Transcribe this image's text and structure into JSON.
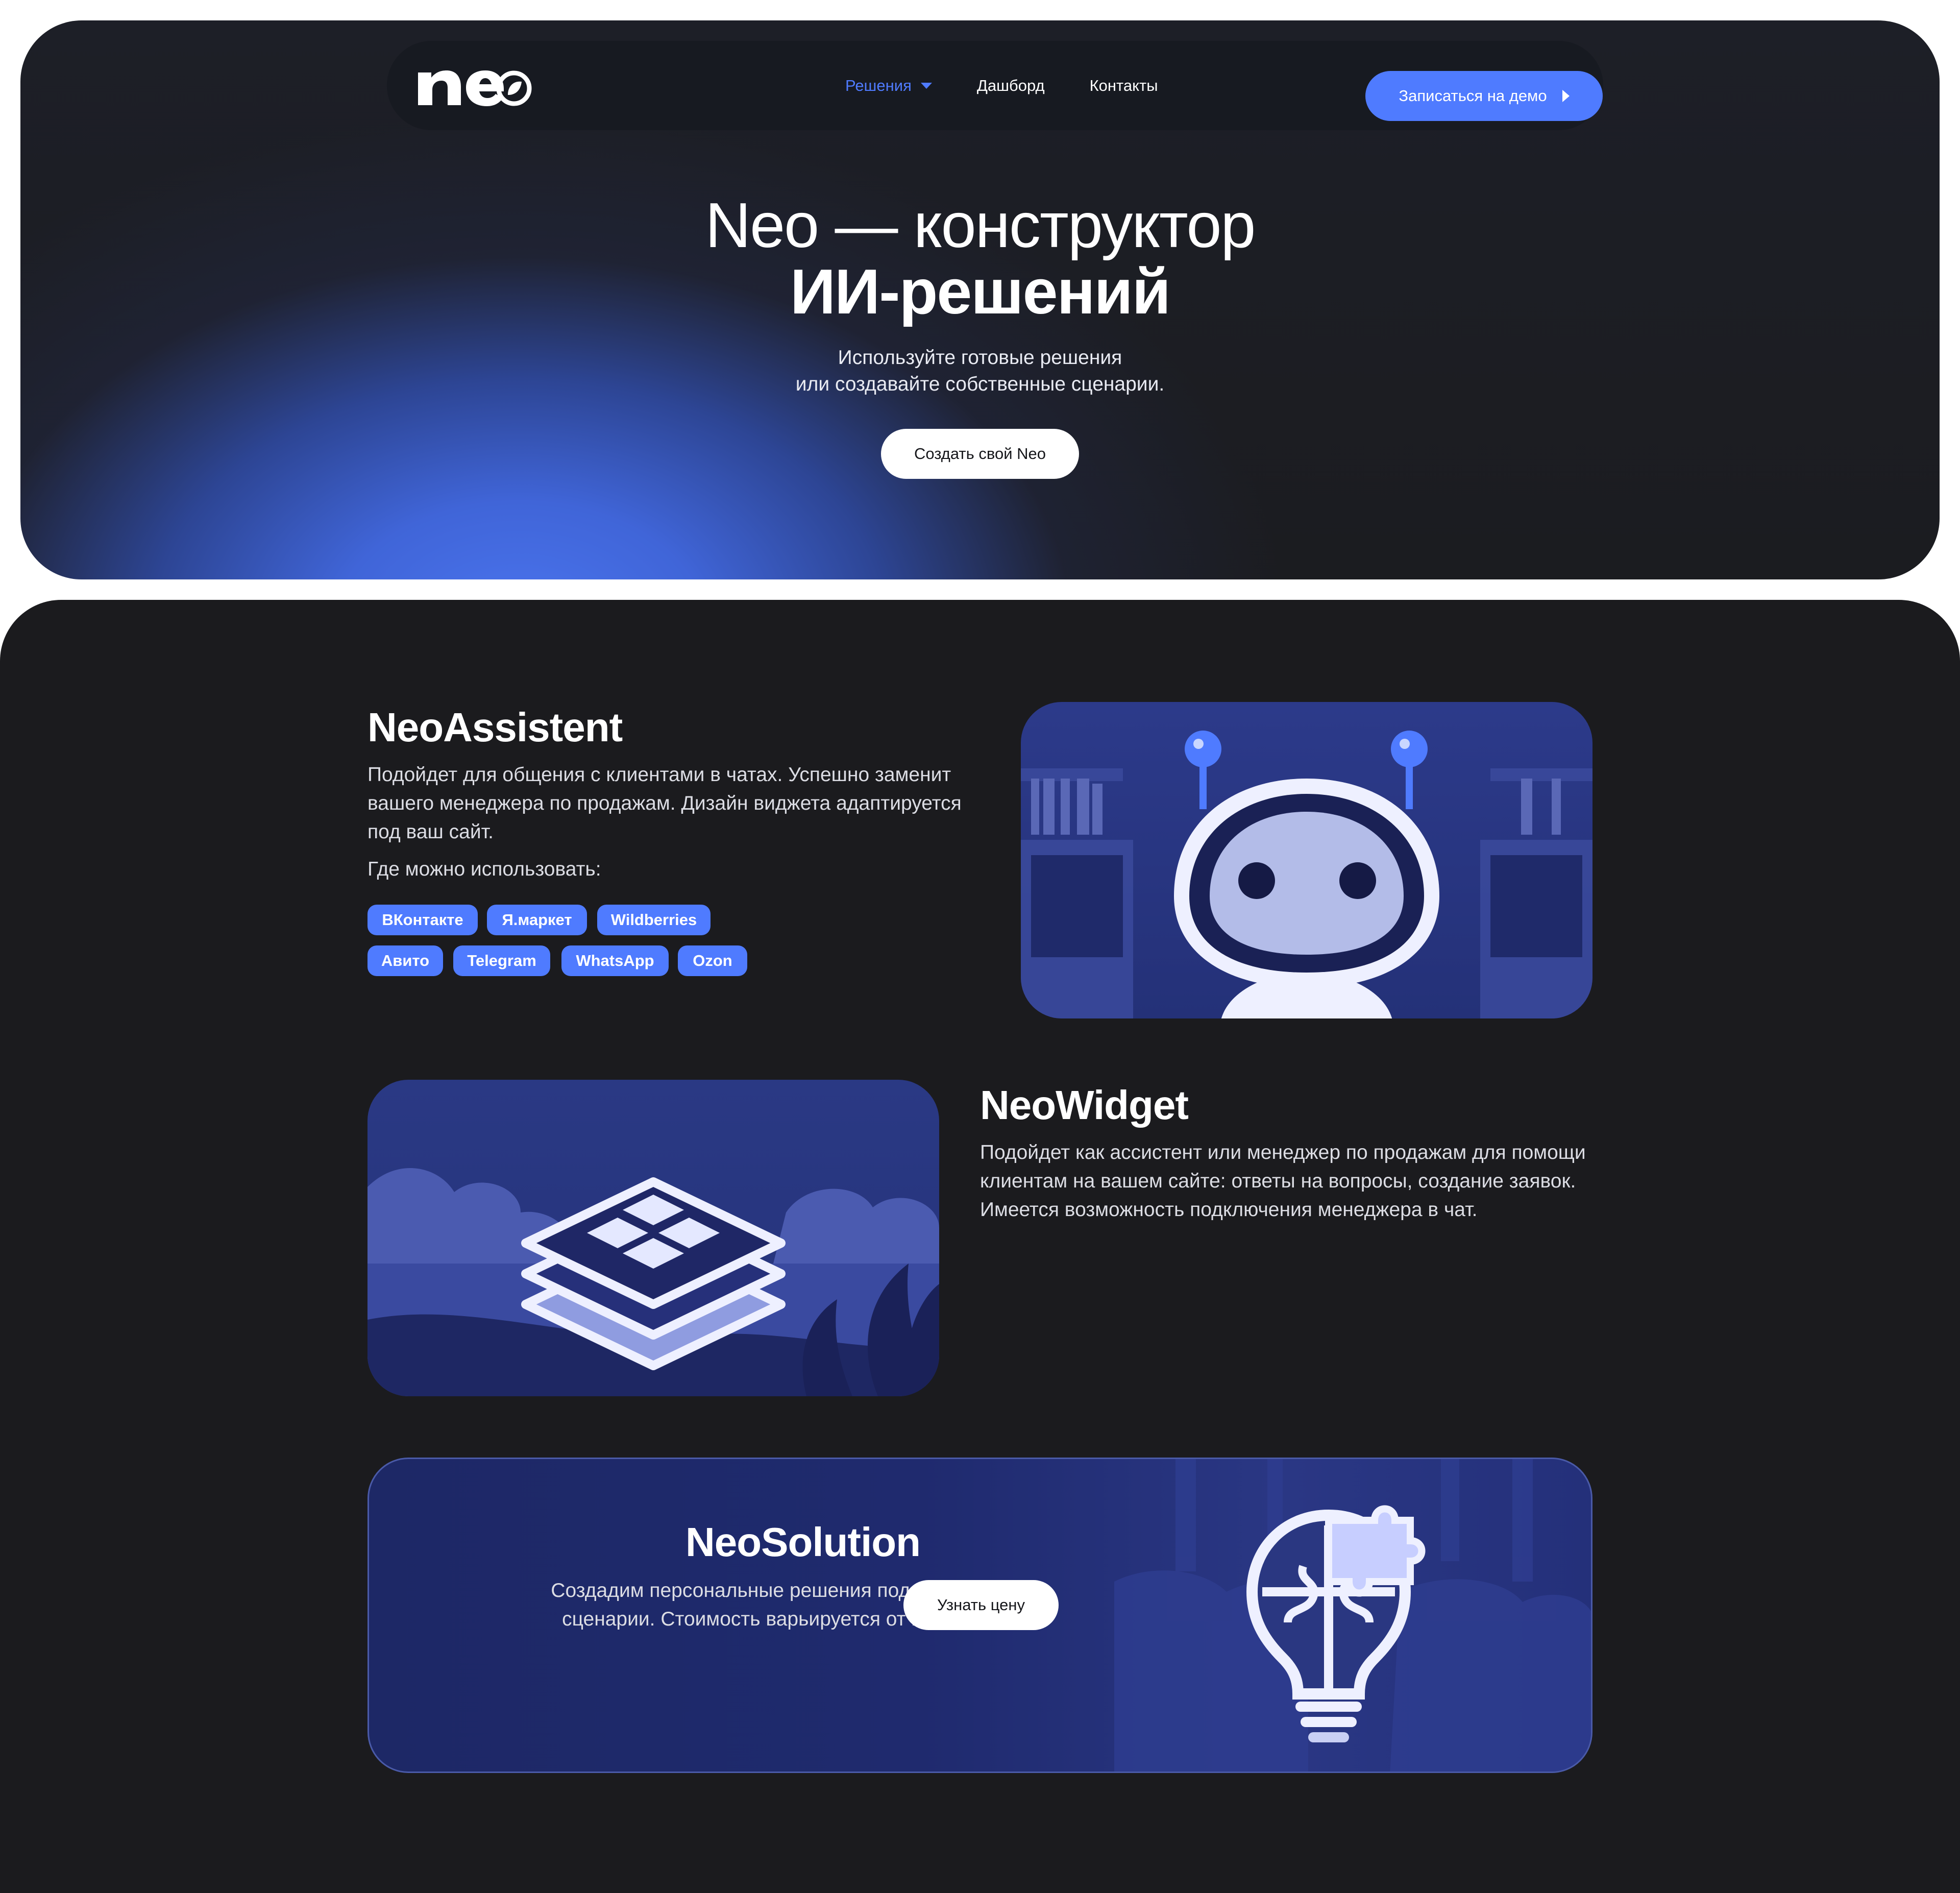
{
  "nav": {
    "logo": "neo",
    "items": [
      {
        "label": "Решения",
        "active": true
      },
      {
        "label": "Дашборд",
        "active": false
      },
      {
        "label": "Контакты",
        "active": false
      }
    ],
    "demo_button": "Записаться на демо"
  },
  "hero": {
    "title_line1": "Neo — конструктор",
    "title_line2": "ИИ-решений",
    "subtitle_line1": "Используйте готовые решения",
    "subtitle_line2": "или создавайте собственные сценарии.",
    "cta": "Создать свой Neo"
  },
  "assistant": {
    "title": "NeoAssistent",
    "text_line1": "Подойдет для общения с клиентами в чатах. Успешно заменит",
    "text_line2": "вашего менеджера по продажам. Дизайн виджета адаптируется",
    "text_line3": "под ваш сайт.",
    "where_label": "Где можно использовать:",
    "tags": [
      "ВКонтакте",
      "Я.маркет",
      "Wildberries",
      "Авито",
      "Telegram",
      "WhatsApp",
      "Ozon"
    ],
    "image_icon": "robot-icon"
  },
  "widget": {
    "title": "NeoWidget",
    "text_line1": "Подойдет как ассистент или менеджер по продажам для помощи",
    "text_line2": "клиентам на вашем сайте: ответы на вопросы, создание заявок.",
    "text_line3": "Имеется возможность подключения менеджера в чат.",
    "image_icon": "layers-icon"
  },
  "solution": {
    "title": "NeoSolution",
    "text_line1": "Создадим персональные решения под любые бизнес-",
    "text_line2": "сценарии. Стоимость варьируется от потребностей.",
    "cta": "Узнать цену",
    "image_icon": "lightbulb-puzzle-icon"
  },
  "colors": {
    "accent": "#4f7bff",
    "page_bg": "#1b1b1e",
    "card_bg": "#24317a"
  }
}
